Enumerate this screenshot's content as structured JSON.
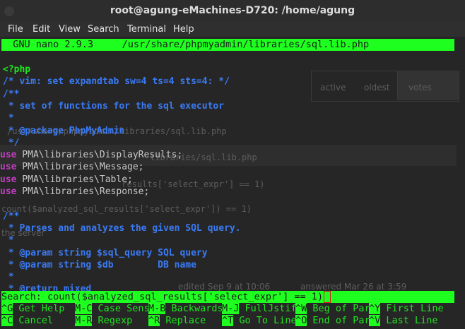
{
  "window": {
    "title": "root@agung-eMachines-D720: /home/agung"
  },
  "menu": [
    "File",
    "Edit",
    "View",
    "Search",
    "Terminal",
    "Help"
  ],
  "nano": {
    "header": "  GNU nano 2.9.3     /usr/share/phpmyadmin/libraries/sql.lib.php",
    "lines": [
      {
        "text": "<?php",
        "color": "c-green"
      },
      {
        "text": "/* vim: set expandtab sw=4 ts=4 sts=4: */",
        "color": "c-blue"
      },
      {
        "text": "/**",
        "color": "c-blue"
      },
      {
        "text": " * set of functions for the sql executor",
        "color": "c-blue"
      },
      {
        "text": " *",
        "color": "c-blue"
      },
      {
        "text": " * @package PhpMyAdmin",
        "color": "c-blue"
      },
      {
        "text": " */",
        "color": "c-blue"
      },
      {
        "kw": "use",
        "rest": " PMA\\libraries\\DisplayResults;"
      },
      {
        "kw": "use",
        "rest": " PMA\\libraries\\Message;"
      },
      {
        "kw": "use",
        "rest": " PMA\\libraries\\Table;"
      },
      {
        "kw": "use",
        "rest": " PMA\\libraries\\Response;"
      },
      {
        "text": "",
        "color": "c-blue"
      },
      {
        "text": "/**",
        "color": "c-blue"
      },
      {
        "text": " * Parses and analyzes the given SQL query.",
        "color": "c-blue"
      },
      {
        "text": " *",
        "color": "c-blue"
      },
      {
        "text": " * @param string $sql_query SQL query",
        "color": "c-blue"
      },
      {
        "text": " * @param string $db        DB name",
        "color": "c-blue"
      },
      {
        "text": " *",
        "color": "c-blue"
      },
      {
        "text": " * @return mixed",
        "color": "c-blue"
      }
    ],
    "search": "Search: count($analyzed_sql_results['select_expr'] == 1)",
    "shortcuts_row1": [
      {
        "key": "^G",
        "label": " Get Help  "
      },
      {
        "key": "M-C",
        "label": " Case Sens"
      },
      {
        "key": "M-B",
        "label": " Backwards"
      },
      {
        "key": "M-J",
        "label": " FullJstif"
      },
      {
        "key": "^W",
        "label": " Beg of Par"
      },
      {
        "key": "^Y",
        "label": " First Line"
      }
    ],
    "shortcuts_row2": [
      {
        "key": "^C",
        "label": " Cancel    "
      },
      {
        "key": "M-R",
        "label": " Regexp   "
      },
      {
        "key": "^R",
        "label": " Replace  "
      },
      {
        "key": "^T",
        "label": " Go To Line"
      },
      {
        "key": "^O",
        "label": " End of Par"
      },
      {
        "key": "^V",
        "label": " Last Line"
      }
    ]
  },
  "ghost": {
    "tab_active": "active",
    "tab_oldest": "oldest",
    "tab_votes": "votes",
    "path1": "/usr/share/phpmyadmin/libraries/sql.lib.php",
    "path2": "libraries/sql.lib.php",
    "code1": "_results['select_expr'] == 1)",
    "code2": "count($analyzed_sql_results['select_expr']) == 1)",
    "server": "the server",
    "edited": "edited Sep 9 at 10:06",
    "answered": "answered Mar 26 at 3:59"
  }
}
